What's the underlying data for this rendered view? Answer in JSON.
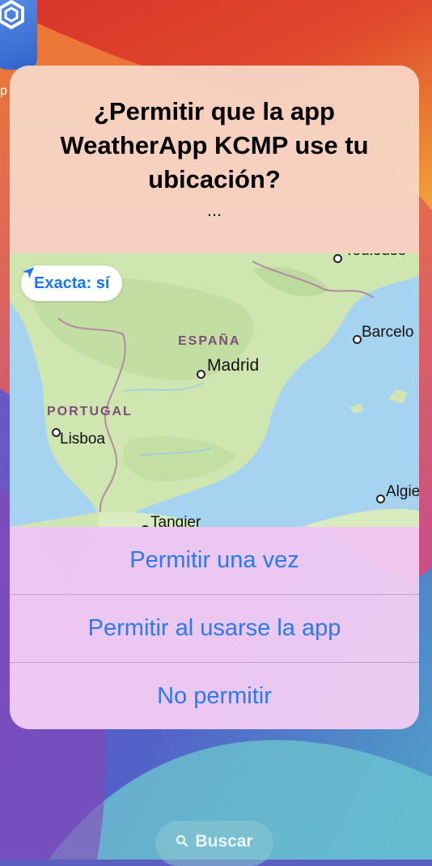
{
  "home_screen": {
    "app_label": "p",
    "search_label": "Buscar"
  },
  "alert": {
    "title": "¿Permitir que la app WeatherApp KCMP use tu ubicación?",
    "message": "...",
    "accuracy_toggle": {
      "label": "Exacta: sí",
      "icon": "location-arrow-icon"
    },
    "map_labels": {
      "spain": "ESPAÑA",
      "madrid": "Madrid",
      "portugal": "PORTUGAL",
      "lisbon": "Lisboa",
      "barcelona": "Barcelo",
      "toulouse": "Toulouse",
      "algiers": "Algie",
      "tangier": "Tangier"
    },
    "buttons": {
      "allow_once": "Permitir una vez",
      "allow_while_using": "Permitir al usarse la app",
      "deny": "No permitir"
    }
  },
  "colors": {
    "accent": "#2a7af0",
    "header_bg": "#f7d8c8",
    "buttons_bg": "#f3ccf3",
    "sea": "#a6d3ef",
    "land": "#cfe6b0"
  }
}
